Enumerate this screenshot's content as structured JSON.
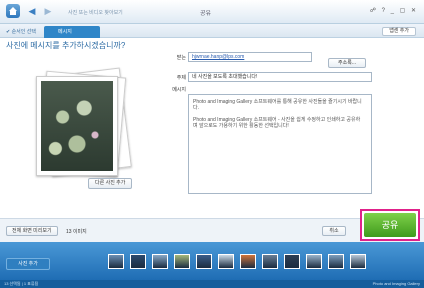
{
  "titlebar": {
    "breadcrumb": "사진 또는 비디오 찾아보기",
    "title": "공유",
    "window_controls": "☍ ? _ ▢ ✕"
  },
  "subbar": {
    "back_label": "✔ 순서인 선택",
    "tab_label": "메시지",
    "help_label": "앱센 추가"
  },
  "heading": "사진에 메시지를 추가하시겠습니까?",
  "form": {
    "to_label": "받는",
    "to_value": "hjwrnae.hanp@lps.com",
    "address_book_label": "주소록...",
    "subject_label": "주제",
    "subject_value": "네 사진을 보도록 초대했습니다!",
    "message_label": "메시지",
    "message_lines": [
      "Photo and Imaging Gallery 소프트웨어를 통해 공유한 사진들을 즐기시기 바랍니다.",
      "Photo and Imaging Gallery 소프트웨어 - 사진을 쉽게 수정하고 인쇄하고 공유하며 앞으로도 가용하기 위한 활동한 선택입니다!"
    ]
  },
  "photo": {
    "other_photo_label": "다른 사진 추가"
  },
  "actions": {
    "fullscreen_label": "전체 화면 미리보기",
    "count_label": "13 이미지",
    "cancel_label": "취소",
    "share_label": "공유"
  },
  "filmstrip": {
    "add_label": "사진 추가",
    "thumb_colors": [
      "#6b8fb5",
      "#2c4a6e",
      "#88a9c7",
      "#a5b87a",
      "#3b5e8a",
      "#c9d9e6",
      "#d1743a",
      "#6a7f96",
      "#2e3f55",
      "#9ab3cb",
      "#7e9fbe",
      "#b7c7d7"
    ]
  },
  "status": {
    "left": "13 선택됨 | 1 표류됨",
    "right": "Photo and Imaging Gallery"
  }
}
